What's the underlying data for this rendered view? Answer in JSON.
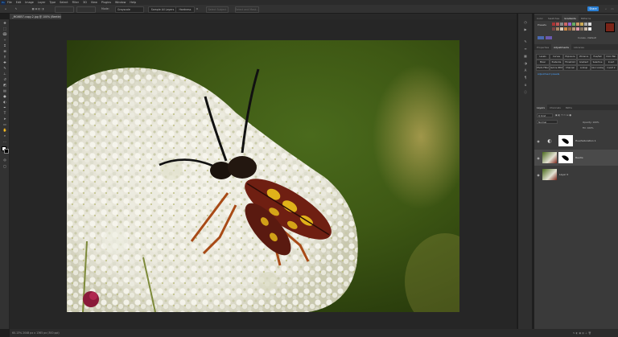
{
  "menubar": {
    "app_icon": "photoshop-logo",
    "app_label": "Ps",
    "items": [
      "File",
      "Edit",
      "Image",
      "Layer",
      "Type",
      "Select",
      "Filter",
      "3D",
      "View",
      "Plugins",
      "Window",
      "Help"
    ]
  },
  "options": {
    "mode_label": "Mode:",
    "mode_value": "Grayscale",
    "sample_all_layers": "Sample All Layers",
    "hardness_label": "Hardness",
    "select_subject": "Select Subject",
    "select_and_mask": "Select and Mask...",
    "share_label": "Share"
  },
  "document": {
    "tab_title": "_MG6857-copy-2.jpg @ 100% (Beetle)*"
  },
  "status": {
    "text": "60.13%   2048 px x 1365 px (300 ppi)"
  },
  "panels": {
    "top_tabs": [
      "Color",
      "Swatches",
      "Gradients",
      "Patterns"
    ],
    "top_active": 2,
    "adjust_tabs": [
      "Properties",
      "Adjustments",
      "Libraries"
    ],
    "adjust_active": 1,
    "preset_label": "Presets",
    "gradient_label": "Curves - Default",
    "buttons_row1": [
      "Levels",
      "Curves",
      "Exposure",
      "Vibrance",
      "Hue/Sat",
      "Color Bal."
    ],
    "buttons_row2": [
      "Mixer",
      "Posterize",
      "Threshold",
      "Gradient",
      "Selective",
      "Invert"
    ],
    "buttons_row3": [
      "Photo Filter",
      "Black & White",
      "Channel",
      "Lookup",
      "Color Lookup",
      "Invert 2"
    ],
    "mid_link": "Adjustment presets",
    "layers_tabs": [
      "Layers",
      "Channels",
      "Paths"
    ],
    "layers_active": 0,
    "kind_label": "Q Kind",
    "blend_mode": "Normal",
    "opacity_label": "Opacity: 100%",
    "fill_label": "Fill: 100%",
    "layers": [
      {
        "name": "Hue/Saturation 1",
        "type": "adjustment"
      },
      {
        "name": "Beetle",
        "type": "image"
      },
      {
        "name": "Layer 0",
        "type": "image"
      }
    ]
  },
  "colors": {
    "accent": "#31a8ff",
    "panel_bg": "#3a3a3a",
    "canvas_bg": "#262626",
    "beetle_red": "#7a2418",
    "beetle_yellow": "#e0b21a",
    "bg_green": "#5f7a1e"
  },
  "icons": {
    "tools": [
      "move-icon",
      "marquee-icon",
      "lasso-icon",
      "magic-wand-icon",
      "crop-icon",
      "frame-icon",
      "eyedropper-icon",
      "healing-icon",
      "brush-icon",
      "stamp-icon",
      "history-brush-icon",
      "eraser-icon",
      "gradient-icon",
      "blur-icon",
      "dodge-icon",
      "pen-icon",
      "type-icon",
      "path-select-icon",
      "shape-icon",
      "hand-icon",
      "zoom-icon",
      "more-tools-icon"
    ],
    "side": [
      "history-icon",
      "actions-icon",
      "brushes-icon",
      "properties-icon",
      "libraries-icon",
      "adjustments-icon",
      "character-icon",
      "paragraph-icon",
      "glyphs-icon",
      "info-icon"
    ]
  }
}
